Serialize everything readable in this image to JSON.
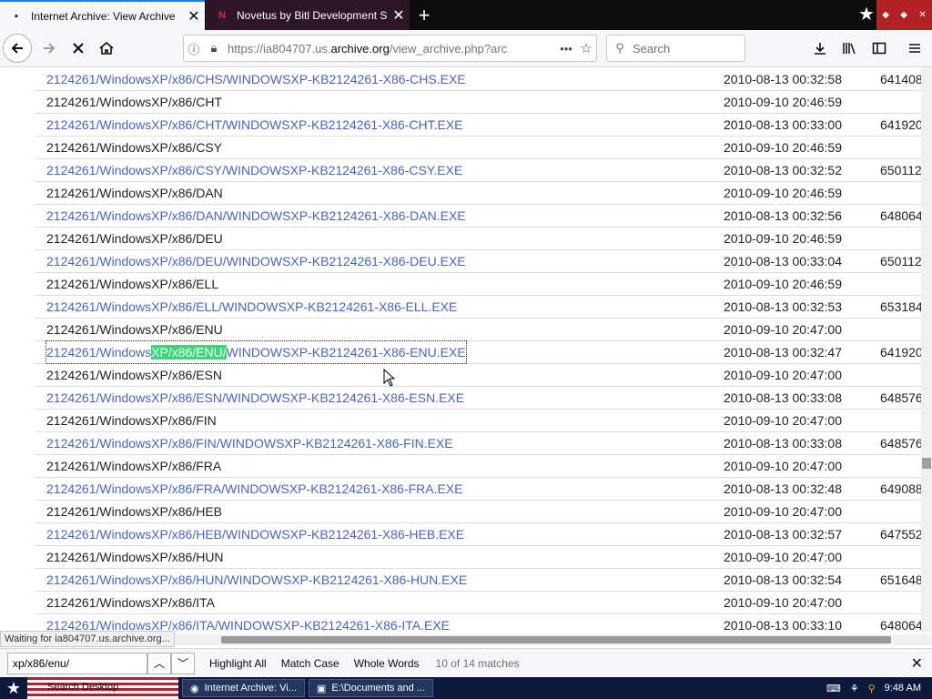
{
  "browser": {
    "tabs": [
      {
        "title": "Internet Archive: View Archive",
        "favicon": "ia-icon"
      },
      {
        "title": "Novetus by Bitl Development Studio",
        "favicon": "novetus-icon"
      }
    ],
    "url": {
      "prefix": "https://ia804707.us.",
      "domain": "archive.org",
      "path": "/view_archive.php?arc"
    },
    "search_placeholder": "Search"
  },
  "rows": [
    {
      "path": "2124261/WindowsXP/x86/CHS/WINDOWSXP-KB2124261-X86-CHS.EXE",
      "date": "2010-08-13 00:32:58",
      "size": "641408",
      "link": true
    },
    {
      "path": "2124261/WindowsXP/x86/CHT",
      "date": "2010-09-10 20:46:59",
      "size": "",
      "link": false
    },
    {
      "path": "2124261/WindowsXP/x86/CHT/WINDOWSXP-KB2124261-X86-CHT.EXE",
      "date": "2010-08-13 00:33:00",
      "size": "641920",
      "link": true
    },
    {
      "path": "2124261/WindowsXP/x86/CSY",
      "date": "2010-09-10 20:46:59",
      "size": "",
      "link": false
    },
    {
      "path": "2124261/WindowsXP/x86/CSY/WINDOWSXP-KB2124261-X86-CSY.EXE",
      "date": "2010-08-13 00:32:52",
      "size": "650112",
      "link": true
    },
    {
      "path": "2124261/WindowsXP/x86/DAN",
      "date": "2010-09-10 20:46:59",
      "size": "",
      "link": false
    },
    {
      "path": "2124261/WindowsXP/x86/DAN/WINDOWSXP-KB2124261-X86-DAN.EXE",
      "date": "2010-08-13 00:32:56",
      "size": "648064",
      "link": true
    },
    {
      "path": "2124261/WindowsXP/x86/DEU",
      "date": "2010-09-10 20:46:59",
      "size": "",
      "link": false
    },
    {
      "path": "2124261/WindowsXP/x86/DEU/WINDOWSXP-KB2124261-X86-DEU.EXE",
      "date": "2010-08-13 00:33:04",
      "size": "650112",
      "link": true
    },
    {
      "path": "2124261/WindowsXP/x86/ELL",
      "date": "2010-09-10 20:46:59",
      "size": "",
      "link": false
    },
    {
      "path": "2124261/WindowsXP/x86/ELL/WINDOWSXP-KB2124261-X86-ELL.EXE",
      "date": "2010-08-13 00:32:53",
      "size": "653184",
      "link": true
    },
    {
      "path": "2124261/WindowsXP/x86/ENU",
      "date": "2010-09-10 20:47:00",
      "size": "",
      "link": false
    },
    {
      "path": "2124261/WindowsXP/x86/ENU/WINDOWSXP-KB2124261-X86-ENU.EXE",
      "date": "2010-08-13 00:32:47",
      "size": "641920",
      "link": true,
      "highlight": [
        "2124261/Windows",
        "XP/x86/ENU/",
        "WINDOWSXP-KB2124261-X86-ENU.EXE"
      ]
    },
    {
      "path": "2124261/WindowsXP/x86/ESN",
      "date": "2010-09-10 20:47:00",
      "size": "",
      "link": false
    },
    {
      "path": "2124261/WindowsXP/x86/ESN/WINDOWSXP-KB2124261-X86-ESN.EXE",
      "date": "2010-08-13 00:33:08",
      "size": "648576",
      "link": true
    },
    {
      "path": "2124261/WindowsXP/x86/FIN",
      "date": "2010-09-10 20:47:00",
      "size": "",
      "link": false
    },
    {
      "path": "2124261/WindowsXP/x86/FIN/WINDOWSXP-KB2124261-X86-FIN.EXE",
      "date": "2010-08-13 00:33:08",
      "size": "648576",
      "link": true
    },
    {
      "path": "2124261/WindowsXP/x86/FRA",
      "date": "2010-09-10 20:47:00",
      "size": "",
      "link": false
    },
    {
      "path": "2124261/WindowsXP/x86/FRA/WINDOWSXP-KB2124261-X86-FRA.EXE",
      "date": "2010-08-13 00:32:48",
      "size": "649088",
      "link": true
    },
    {
      "path": "2124261/WindowsXP/x86/HEB",
      "date": "2010-09-10 20:47:00",
      "size": "",
      "link": false
    },
    {
      "path": "2124261/WindowsXP/x86/HEB/WINDOWSXP-KB2124261-X86-HEB.EXE",
      "date": "2010-08-13 00:32:57",
      "size": "647552",
      "link": true
    },
    {
      "path": "2124261/WindowsXP/x86/HUN",
      "date": "2010-09-10 20:47:00",
      "size": "",
      "link": false
    },
    {
      "path": "2124261/WindowsXP/x86/HUN/WINDOWSXP-KB2124261-X86-HUN.EXE",
      "date": "2010-08-13 00:32:54",
      "size": "651648",
      "link": true
    },
    {
      "path": "2124261/WindowsXP/x86/ITA",
      "date": "2010-09-10 20:47:00",
      "size": "",
      "link": false
    },
    {
      "path": "2124261/WindowsXP/x86/ITA/WINDOWSXP-KB2124261-X86-ITA.EXE",
      "date": "2010-08-13 00:33:10",
      "size": "648064",
      "link": true
    }
  ],
  "status": "Waiting for ia804707.us.archive.org...",
  "findbar": {
    "query": "xp/x86/enu/",
    "highlight_all": "Highlight All",
    "match_case": "Match Case",
    "whole_words": "Whole Words",
    "status": "10 of 14 matches"
  },
  "taskbar": {
    "flag_label": "Search Desktop",
    "tasks": [
      {
        "label": "Internet Archive: Vi..."
      },
      {
        "label": "E:\\Documents and ..."
      }
    ],
    "clock": "9:48 AM"
  },
  "colors": {
    "link": "#4863c8",
    "find_highlight": "#38d878",
    "tab_accent": "#0a84ff"
  }
}
